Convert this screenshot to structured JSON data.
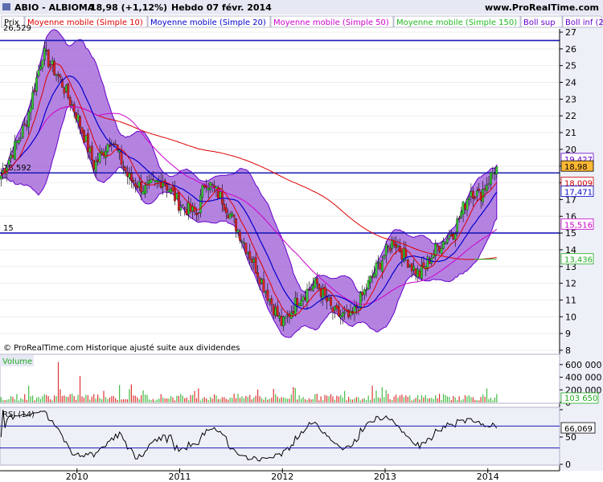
{
  "header": {
    "symbol": "ABIO - ALBIOMA",
    "last": "18,98 (+1,12%)",
    "period": "Hebdo  07 févr. 2014",
    "site": "www.ProRealTime.com"
  },
  "legend": [
    {
      "label": "Prix",
      "color": "#000000",
      "bg": "#ffffff"
    },
    {
      "label": "Moyenne mobile (Simple 10)",
      "color": "#dd0000",
      "bg": "#ffffff"
    },
    {
      "label": "Moyenne mobile (Simple 20)",
      "color": "#0000cc",
      "bg": "#ffffff"
    },
    {
      "label": "Moyenne mobile (Simple 50)",
      "color": "#cc00cc",
      "bg": "#ffffff"
    },
    {
      "label": "Moyenne mobile (Simple 150)",
      "color": "#22bb22",
      "bg": "#ffffff"
    },
    {
      "label": "Boll sup",
      "color": "#6600cc",
      "bg": "#ffffff"
    },
    {
      "label": "Boll inf (20 2)",
      "color": "#6600cc",
      "bg": "#ffffff"
    }
  ],
  "footer_note": "© ProRealTime.com  Historique ajusté suite aux dividendes",
  "panels": {
    "volume_title": "Volume",
    "rsi_title": "RSI (14)"
  },
  "chart_data": [
    {
      "type": "candlestick",
      "panel": "price",
      "ylim": [
        8,
        27
      ],
      "y_ticks": [
        "8",
        "9",
        "10",
        "11",
        "12",
        "13",
        "14",
        "15",
        "16",
        "17",
        "18",
        "19",
        "20",
        "21",
        "22",
        "23",
        "24",
        "25",
        "26",
        "27"
      ],
      "x_ticks": [
        "2010",
        "2011",
        "2012",
        "2013",
        "2014"
      ],
      "x_range": [
        "2009-04",
        "2014-02"
      ],
      "top_left_value": "26,529",
      "horizontal_lines": [
        {
          "value": 26.5,
          "label": ""
        },
        {
          "value": 18.592,
          "label": "18,592"
        },
        {
          "value": 15,
          "label": "15"
        }
      ],
      "right_labels": [
        {
          "value": 19.427,
          "text": "19,427",
          "color": "#6600cc"
        },
        {
          "value": 18.98,
          "text": "18,98",
          "color": "#000000",
          "bg": "#ffb833"
        },
        {
          "value": 18.0,
          "text": "18,009",
          "color": "#cc0000"
        },
        {
          "value": 17.471,
          "text": "17,471",
          "color": "#0000cc"
        },
        {
          "value": 15.516,
          "text": "15,516",
          "color": "#cc00cc"
        },
        {
          "value": 13.436,
          "text": "13,436",
          "color": "#22aa22"
        }
      ],
      "price_anchors": [
        [
          "2009-04",
          18.3
        ],
        [
          "2009-07",
          21.5
        ],
        [
          "2009-09",
          25.8
        ],
        [
          "2009-11",
          24.2
        ],
        [
          "2010-01",
          22.0
        ],
        [
          "2010-03",
          19.0
        ],
        [
          "2010-05",
          20.7
        ],
        [
          "2010-07",
          18.3
        ],
        [
          "2010-09",
          17.6
        ],
        [
          "2010-11",
          18.2
        ],
        [
          "2011-01",
          16.7
        ],
        [
          "2011-03",
          16.1
        ],
        [
          "2011-04",
          18.2
        ],
        [
          "2011-06",
          17.0
        ],
        [
          "2011-08",
          15.0
        ],
        [
          "2011-10",
          12.8
        ],
        [
          "2011-12",
          10.5
        ],
        [
          "2012-01",
          9.5
        ],
        [
          "2012-03",
          11.2
        ],
        [
          "2012-05",
          12.0
        ],
        [
          "2012-07",
          10.2
        ],
        [
          "2012-09",
          9.9
        ],
        [
          "2012-10",
          10.9
        ],
        [
          "2012-12",
          12.9
        ],
        [
          "2013-02",
          14.6
        ],
        [
          "2013-04",
          13.1
        ],
        [
          "2013-05",
          12.5
        ],
        [
          "2013-07",
          14.1
        ],
        [
          "2013-09",
          15.1
        ],
        [
          "2013-11",
          17.6
        ],
        [
          "2013-12",
          17.2
        ],
        [
          "2014-02",
          18.98
        ]
      ],
      "ma_end_values": {
        "ma10": 18.009,
        "ma20": 17.471,
        "ma50": 15.516,
        "ma150": 13.436,
        "boll_sup": 19.427
      }
    },
    {
      "type": "bar",
      "panel": "volume",
      "ylim": [
        0,
        700000
      ],
      "y_ticks": [
        "0",
        "200 000",
        "400 000",
        "600 000"
      ],
      "last_value": "103 650"
    },
    {
      "type": "line",
      "panel": "rsi",
      "ylim": [
        0,
        100
      ],
      "y_ticks": [
        "0",
        "50",
        "100"
      ],
      "last_value": "66,069",
      "levels": [
        30,
        70
      ]
    }
  ],
  "colors": {
    "boll_fill": "#9b59d6",
    "boll_line": "#6600cc",
    "up": "#33cc33",
    "down": "#dd2222",
    "hline": "#1a1ab8",
    "axis_bg": "#eef0f8",
    "price_bg": "#ffffff"
  }
}
